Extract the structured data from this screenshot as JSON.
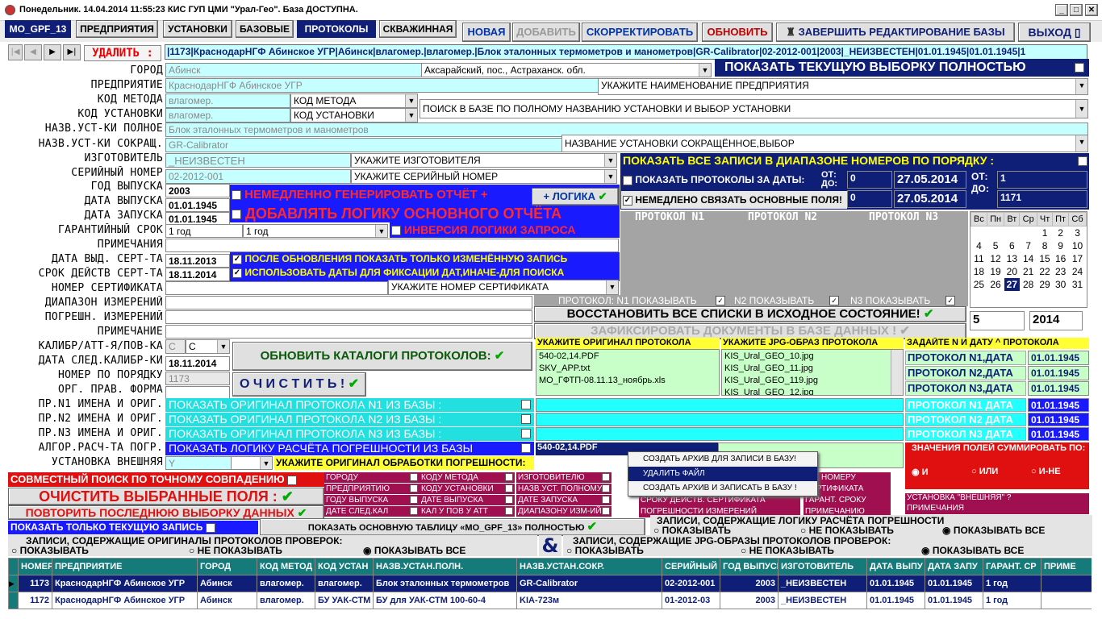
{
  "title": "Понедельник. 14.04.2014 11:55:23  КИС ГУП ЦМИ \"Урал-Гео\". База ДОСТУПНА.",
  "tabs": [
    "MO_GPF_13",
    "ПРЕДПРИЯТИЯ",
    "УСТАНОВКИ",
    "БАЗОВЫЕ",
    "ПРОТОКОЛЫ",
    "СКВАЖИННАЯ"
  ],
  "toolbar": {
    "new": "НОВАЯ",
    "add": "ДОБАВИТЬ",
    "correct": "СКОРРЕКТИРОВАТЬ",
    "refresh": "ОБНОВИТЬ",
    "finish": "ЗАВЕРШИТЬ РЕДАКТИРОВАНИЕ БАЗЫ",
    "exit": "ВЫХОД"
  },
  "delete_label": "УДАЛИТЬ :",
  "record_line": "|1173|КраснодарНГФ Абинское УГР|Абинск|влагомер.|влагомер.|Блок эталонных термометров и манометров|GR-Calibrator|02-2012-001|2003|_НЕИЗВЕСТЕН|01.01.1945|01.01.1945|1",
  "labels": [
    "ГОРОД",
    "ПРЕДПРИЯТИЕ",
    "КОД МЕТОДА",
    "КОД УСТАНОВКИ",
    "НАЗВ.УСТ-КИ ПОЛНОЕ",
    "НАЗВ.УСТ-КИ СОКРАЩ.",
    "ИЗГОТОВИТЕЛЬ",
    "СЕРИЙНЫЙ НОМЕР",
    "ГОД ВЫПУСКА",
    "ДАТА ВЫПУСКА",
    "ДАТА ЗАПУСКА",
    "ГАРАНТИЙНЫЙ СРОК",
    "ПРИМЕЧАНИЯ",
    "ДАТА ВЫД. СЕРТ-ТА",
    "СРОК ДЕЙСТВ СЕРТ-ТА",
    "НОМЕР СЕРТИФИКАТА",
    "ДИАПАЗОН ИЗМЕРЕНИЙ",
    "ПОГРЕШН. ИЗМЕРЕНИЙ",
    "ПРИМЕЧАНИЕ",
    "КАЛИБР/АТТ-Я/ПОВ-КА",
    "ДАТА СЛЕД.КАЛИБР-КИ",
    "НОМЕР ПО ПОРЯДКУ",
    "ОРГ. ПРАВ. ФОРМА",
    "ПР.N1 ИМЕНА И ОРИГ.",
    "ПР.N2 ИМЕНА И ОРИГ.",
    "ПР.N3 ИМЕНА И ОРИГ.",
    "АЛГОР.РАСЧ-ТА ПОГР.",
    "УСТАНОВКА ВНЕШНЯЯ"
  ],
  "values": {
    "city": "Абинск",
    "city_combo": "Аксарайский, пос., Астраханск. обл.",
    "enterprise": "КраснодарНГФ Абинское УГР",
    "enterprise_combo": "УКАЖИТЕ НАИМЕНОВАНИЕ ПРЕДПРИЯТИЯ",
    "method": "влагомер.",
    "method_combo": "КОД МЕТОДА",
    "install": "влагомер.",
    "install_combo": "КОД УСТАНОВКИ",
    "search_install": "ПОИСК В БАЗЕ ПО ПОЛНОМУ НАЗВАНИЮ УСТАНОВКИ И ВЫБОР УСТАНОВКИ",
    "full_name": "Блок эталонных термометров и манометров",
    "short_name": "GR-Calibrator",
    "short_combo": "НАЗВАНИЕ УСТАНОВКИ СОКРАЩЁННОЕ,ВЫБОР",
    "maker": "_НЕИЗВЕСТЕН",
    "maker_combo": "УКАЖИТЕ ИЗГОТОВИТЕЛЯ",
    "serial": "02-2012-001",
    "serial_combo": "УКАЖИТЕ СЕРИЙНЫЙ НОМЕР",
    "year": "2003",
    "release": "01.01.1945",
    "launch": "01.01.1945",
    "warranty": "1 год",
    "warranty_combo": "1 год",
    "cert_date": "18.11.2013",
    "cert_term": "18.11.2014",
    "cert_combo": "УКАЖИТЕ НОМЕР СЕРТИФИКАТА",
    "calib": "С",
    "calib_combo": "С",
    "next_calib": "18.11.2014",
    "order_no": "1173",
    "external": "Y"
  },
  "show_current": "ПОКАЗАТЬ ТЕКУЩУЮ ВЫБОРКУ ПОЛНОСТЬЮ",
  "gen_report": "НЕМЕДЛЕННО ГЕНЕРИРОВАТЬ ОТЧЁТ +",
  "plus_logic": "+ ЛОГИКА",
  "add_logic": "ДОБАВЛЯТЬ ЛОГИКУ ОСНОВНОГО ОТЧЁТА",
  "inversion": "ИНВЕРСИЯ ЛОГИКИ ЗАПРОСА",
  "after_update": "ПОСЛЕ ОБНОВЛЕНИЯ ПОКАЗАТЬ ТОЛЬКО ИЗМЕНЁННУЮ ЗАПИСЬ",
  "use_dates": "ИСПОЛЬЗОВАТЬ ДАТЫ ДЛЯ ФИКСАЦИИ ДАТ,ИНАЧЕ-ДЛЯ ПОИСКА",
  "range": {
    "title": "ПОКАЗАТЬ ВСЕ ЗАПИСИ В ДИАПАЗОНЕ НОМЕРОВ ПО ПОРЯДКУ :",
    "protocols_by_date": "ПОКАЗАТЬ ПРОТОКОЛЫ ЗА ДАТЫ:",
    "link": "НЕМЕДЛЕНО СВЯЗАТЬ ОСНОВНЫЕ ПОЛЯ!",
    "from": "ОТ:",
    "to": "ДО:",
    "n_from": "0",
    "n_to": "0",
    "d_from": "27.05.2014",
    "d_to": "27.05.2014",
    "r_from": "1",
    "r_to": "1171"
  },
  "protocols": {
    "n1": "ПРОТОКОЛ N1",
    "n2": "ПРОТОКОЛ N2",
    "n3": "ПРОТОКОЛ N3",
    "show": "ПРОТОКОЛ: N1 ПОКАЗЫВАТЬ",
    "show2": "N2 ПОКАЗЫВАТЬ",
    "show3": "N3 ПОКАЗЫВАТЬ"
  },
  "calendar": {
    "days": [
      "Вс",
      "Пн",
      "Вт",
      "Ср",
      "Чт",
      "Пт",
      "Сб"
    ],
    "weeks": [
      [
        "",
        "",
        "",
        "",
        "1",
        "2",
        "3"
      ],
      [
        "4",
        "5",
        "6",
        "7",
        "8",
        "9",
        "10"
      ],
      [
        "11",
        "12",
        "13",
        "14",
        "15",
        "16",
        "17"
      ],
      [
        "18",
        "19",
        "20",
        "21",
        "22",
        "23",
        "24"
      ],
      [
        "25",
        "26",
        "27",
        "28",
        "29",
        "30",
        "31"
      ]
    ],
    "month": "5",
    "year": "2014"
  },
  "restore": "ВОССТАНОВИТЬ ВСЕ СПИСКИ В ИСХОДНОЕ СОСТОЯНИЕ!",
  "fix_docs": "ЗАФИКСИРОВАТЬ ДОКУМЕНТЫ В БАЗЕ ДАННЫХ !",
  "update_catalogs": "ОБНОВИТЬ КАТАЛОГИ ПРОТОКОЛОВ:",
  "clear": "О Ч И С Т И Т Ь !",
  "orig_header": "УКАЖИТЕ ОРИГИНАЛ ПРОТОКОЛА",
  "orig_files": [
    "540-02,14.PDF",
    "SKV_APP.txt",
    "МО_ГФТП-08.11.13_ноябрь.xls"
  ],
  "jpg_header": "УКАЖИТЕ JPG-ОБРАЗ ПРОТОКОЛА",
  "jpg_files": [
    "KIS_Ural_GEO_10.jpg",
    "KIS_Ural_GEO_11.jpg",
    "KIS_Ural_GEO_119.jpg",
    "KIS_Ural_GEO_12.jpg"
  ],
  "date_header": "ЗАДАЙТЕ N И ДАТУ ^ ПРОТОКОЛА",
  "proto_dates": [
    [
      "ПРОТОКОЛ N1,ДАТА",
      "01.01.1945"
    ],
    [
      "ПРОТОКОЛ N2,ДАТА",
      "01.01.1945"
    ],
    [
      "ПРОТОКОЛ N3,ДАТА",
      "01.01.1945"
    ]
  ],
  "proto_dates2": [
    [
      "ПРОТОКОЛ N1 ДАТА",
      "01.01.1945"
    ],
    [
      "ПРОТОКОЛ N2 ДАТА",
      "01.01.1945"
    ],
    [
      "ПРОТОКОЛ N3 ДАТА",
      "01.01.1945"
    ]
  ],
  "show_orig": [
    "ПОКАЗАТЬ ОРИГИНАЛ ПРОТОКОЛА N1 ИЗ БАЗЫ :",
    "ПОКАЗАТЬ ОРИГИНАЛ ПРОТОКОЛА N2 ИЗ БАЗЫ :",
    "ПОКАЗАТЬ ОРИГИНАЛ ПРОТОКОЛА N3 ИЗ БАЗЫ :"
  ],
  "show_logic": "ПОКАЗАТЬ ЛОГИКУ РАСЧЁТА ПОГРЕШНОСТИ ИЗ БАЗЫ",
  "err_file": "540-02,14.PDF",
  "err_orig": "УКАЖИТЕ ОРИГИНАЛ ОБРАБОТКИ ПОГРЕШНОСТИ:",
  "sum_title": "ЗНАЧЕНИЯ ПОЛЕЙ СУММИРОВАТЬ ПО:",
  "sum_opts": [
    "И",
    "ИЛИ",
    "И-НЕ"
  ],
  "context": [
    "СОЗДАТЬ АРХИВ ДЛЯ ЗАПИСИ В БАЗУ!",
    "УДАЛИТЬ ФАЙЛ",
    "СОЗДАТЬ АРХИВ И ЗАПИСАТЬ В БАЗУ !"
  ],
  "joint": "СОВМЕСТНЫЙ ПОИСК ПО ТОЧНОМУ СОВПАДЕНИЮ",
  "clear_sel": "ОЧИСТИТЬ  ВЫБРАННЫЕ  ПОЛЯ :",
  "repeat": "ПОВТОРИТЬ ПОСЛЕДНЮЮ ВЫБОРКУ ДАННЫХ",
  "only_current": "ПОКАЗАТЬ ТОЛЬКО ТЕКУЩУЮ ЗАПИСЬ",
  "main_table": "ПОКАЗАТЬ ОСНОВНУЮ ТАБЛИЦУ «MO_GPF_13» ПОЛНОСТЬЮ",
  "filters": [
    [
      "ГОРОДУ",
      "КОДУ МЕТОДА",
      "ИЗГОТОВИТЕЛЮ"
    ],
    [
      "ПРЕДПРИЯТИЮ",
      "КОДУ УСТАНОВКИ",
      "НАЗВ.УСТ. ПОЛНОМУ"
    ],
    [
      "ГОДУ ВЫПУСКА",
      "ДАТЕ ВЫПУСКА",
      "ДАТЕ ЗАПУСКА"
    ],
    [
      "ДАТЕ СЛЕД.КАЛ",
      "КАЛ У ПОВ У АТТ",
      "ДИАПАЗОНУ ИЗМ-ИЙ"
    ]
  ],
  "filters2": [
    "ЙН. НОМЕРУ",
    "СЕРТИФИКАТА",
    "ГАРАНТ. СРОКУ",
    "ПРИМЕЧАНИЮ"
  ],
  "filters3": [
    "СРОКУ ДЕЙСТВ. СЕРТИФИКАТА",
    "ПОГРЕШНОСТИ ИЗМЕРЕНИЙ"
  ],
  "filters4": [
    "УСТАНОВКА \"ВНЕШНЯЯ\" ?",
    "ПРИМЕЧАНИЯ"
  ],
  "logic_group": {
    "title": "ЗАПИСИ, СОДЕРЖАЩИЕ ЛОГИКУ  РАСЧЁТА ПОГРЕШНОСТИ",
    "opts": [
      "ПОКАЗЫВАТЬ",
      "НЕ ПОКАЗЫВАТЬ",
      "ПОКАЗЫВАТЬ ВСЕ"
    ]
  },
  "orig_group": {
    "title": "ЗАПИСИ, СОДЕРЖАЩИЕ ОРИГИНАЛЫ ПРОТОКОЛОВ ПРОВЕРОК:",
    "opts": [
      "ПОКАЗЫВАТЬ",
      "НЕ ПОКАЗЫВАТЬ",
      "ПОКАЗЫВАТЬ ВСЕ"
    ]
  },
  "jpg_group": {
    "title": "ЗАПИСИ, СОДЕРЖАЩИЕ JPG-ОБРАЗЫ ПРОТОКОЛОВ ПРОВЕРОК:",
    "opts": [
      "ПОКАЗЫВАТЬ",
      "НЕ ПОКАЗЫВАТЬ",
      "ПОКАЗЫВАТЬ ВСЕ"
    ]
  },
  "amp": "&",
  "table": {
    "headers": [
      "НОМЕР",
      "ПРЕДПРИЯТИЕ",
      "ГОРОД",
      "КОД МЕТОД",
      "КОД УСТАН",
      "НАЗВ.УСТАН.ПОЛН.",
      "НАЗВ.УСТАН.СОКР.",
      "СЕРИЙНЫЙ",
      "ГОД ВЫПУСКА",
      "ИЗГОТОВИТЕЛЬ",
      "ДАТА ВЫПУ",
      "ДАТА ЗАПУ",
      "ГАРАНТ. СР",
      "ПРИМЕ"
    ],
    "rows": [
      [
        "1173",
        "КраснодарНГФ Абинское УГР",
        "Абинск",
        "влагомер.",
        "влагомер.",
        "Блок эталонных термометров",
        "GR-Calibrator",
        "02-2012-001",
        "2003",
        "_НЕИЗВЕСТЕН",
        "01.01.1945",
        "01.01.1945",
        "1 год",
        ""
      ],
      [
        "1172",
        "КраснодарНГФ Абинское УГР",
        "Абинск",
        "влагомер.",
        "БУ УАК-СТМ",
        "БУ для УАК-СТМ 100-60-4",
        "KIA-723м",
        "01-2012-03",
        "2003",
        "_НЕИЗВЕСТЕН",
        "01.01.1945",
        "01.01.1945",
        "1 год",
        ""
      ]
    ]
  }
}
